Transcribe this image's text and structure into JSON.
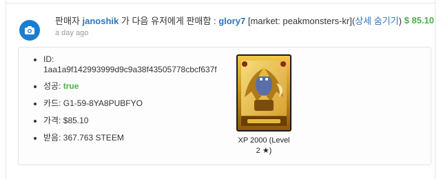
{
  "header": {
    "seller_prefix": "판매자",
    "seller": "janoshik",
    "middle_text": "가 다음 유저에게 판매함 :",
    "buyer": "glory7",
    "market": "[market: peakmonsters-kr]",
    "toggle_open": "(",
    "toggle_label": "상세 숨기기",
    "toggle_close": ")",
    "time": "a day ago",
    "amount": "$ 85.10",
    "icon": "cart-icon"
  },
  "details": {
    "id_label": "ID:",
    "id_value": "1aa1a9f142993999d9c9a38f43505778cbcf637f",
    "success_label": "성공:",
    "success_value": "true",
    "card_label": "카드:",
    "card_value": "G1-59-8YA8PUBFYO",
    "price_label": "가격:",
    "price_value": "$85.10",
    "received_label": "받음:",
    "received_value": "367.763 STEEM"
  },
  "card": {
    "caption_line1": "XP 2000 (Level",
    "caption_line2": "2 ★)",
    "image": "golden-dragon-card-image"
  },
  "colors": {
    "link": "#2c74b8",
    "amount": "#4cae4c",
    "icon_bg": "#1a7ed0"
  }
}
